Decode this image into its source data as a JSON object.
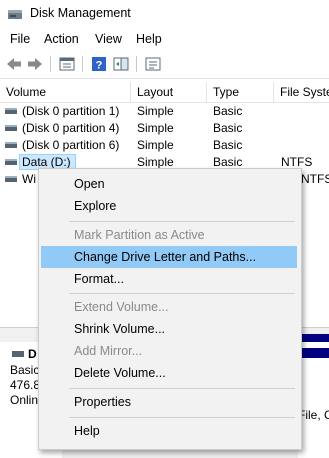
{
  "window": {
    "title": "Disk Management"
  },
  "menu": [
    "File",
    "Action",
    "View",
    "Help"
  ],
  "toolbar": {
    "icons": [
      "back-arrow-icon",
      "forward-arrow-icon",
      "properties-list-icon",
      "help-icon",
      "action-pane-icon",
      "console-tree-icon"
    ]
  },
  "volume_list": {
    "columns": [
      "Volume",
      "Layout",
      "Type",
      "File Syste"
    ],
    "rows": [
      {
        "volume": "(Disk 0 partition 1)",
        "layout": "Simple",
        "type": "Basic",
        "fs": ""
      },
      {
        "volume": "(Disk 0 partition 4)",
        "layout": "Simple",
        "type": "Basic",
        "fs": ""
      },
      {
        "volume": "(Disk 0 partition 6)",
        "layout": "Simple",
        "type": "Basic",
        "fs": ""
      },
      {
        "volume": "Data (D:)",
        "layout": "Simple",
        "type": "Basic",
        "fs": "NTFS"
      },
      {
        "volume": "Wi",
        "layout": "",
        "type": "",
        "fs": "NTFS"
      }
    ]
  },
  "disk_panel": {
    "name": "D",
    "lines": [
      "Basic",
      "476.8",
      "Onlin"
    ],
    "partition_text": "File, C"
  },
  "context_menu": {
    "items": [
      {
        "label": "Open",
        "disabled": false
      },
      {
        "label": "Explore",
        "disabled": false
      },
      {
        "label": "Mark Partition as Active",
        "disabled": true
      },
      {
        "label": "Change Drive Letter and Paths...",
        "disabled": false,
        "highlighted": true
      },
      {
        "label": "Format...",
        "disabled": false
      },
      {
        "label": "Extend Volume...",
        "disabled": true
      },
      {
        "label": "Shrink Volume...",
        "disabled": false
      },
      {
        "label": "Add Mirror...",
        "disabled": true
      },
      {
        "label": "Delete Volume...",
        "disabled": false
      },
      {
        "label": "Properties",
        "disabled": false
      },
      {
        "label": "Help",
        "disabled": false
      }
    ]
  },
  "colors": {
    "selection": "#cce8ff",
    "menu_highlight": "#91c9f7",
    "disk_bar": "#000080"
  }
}
